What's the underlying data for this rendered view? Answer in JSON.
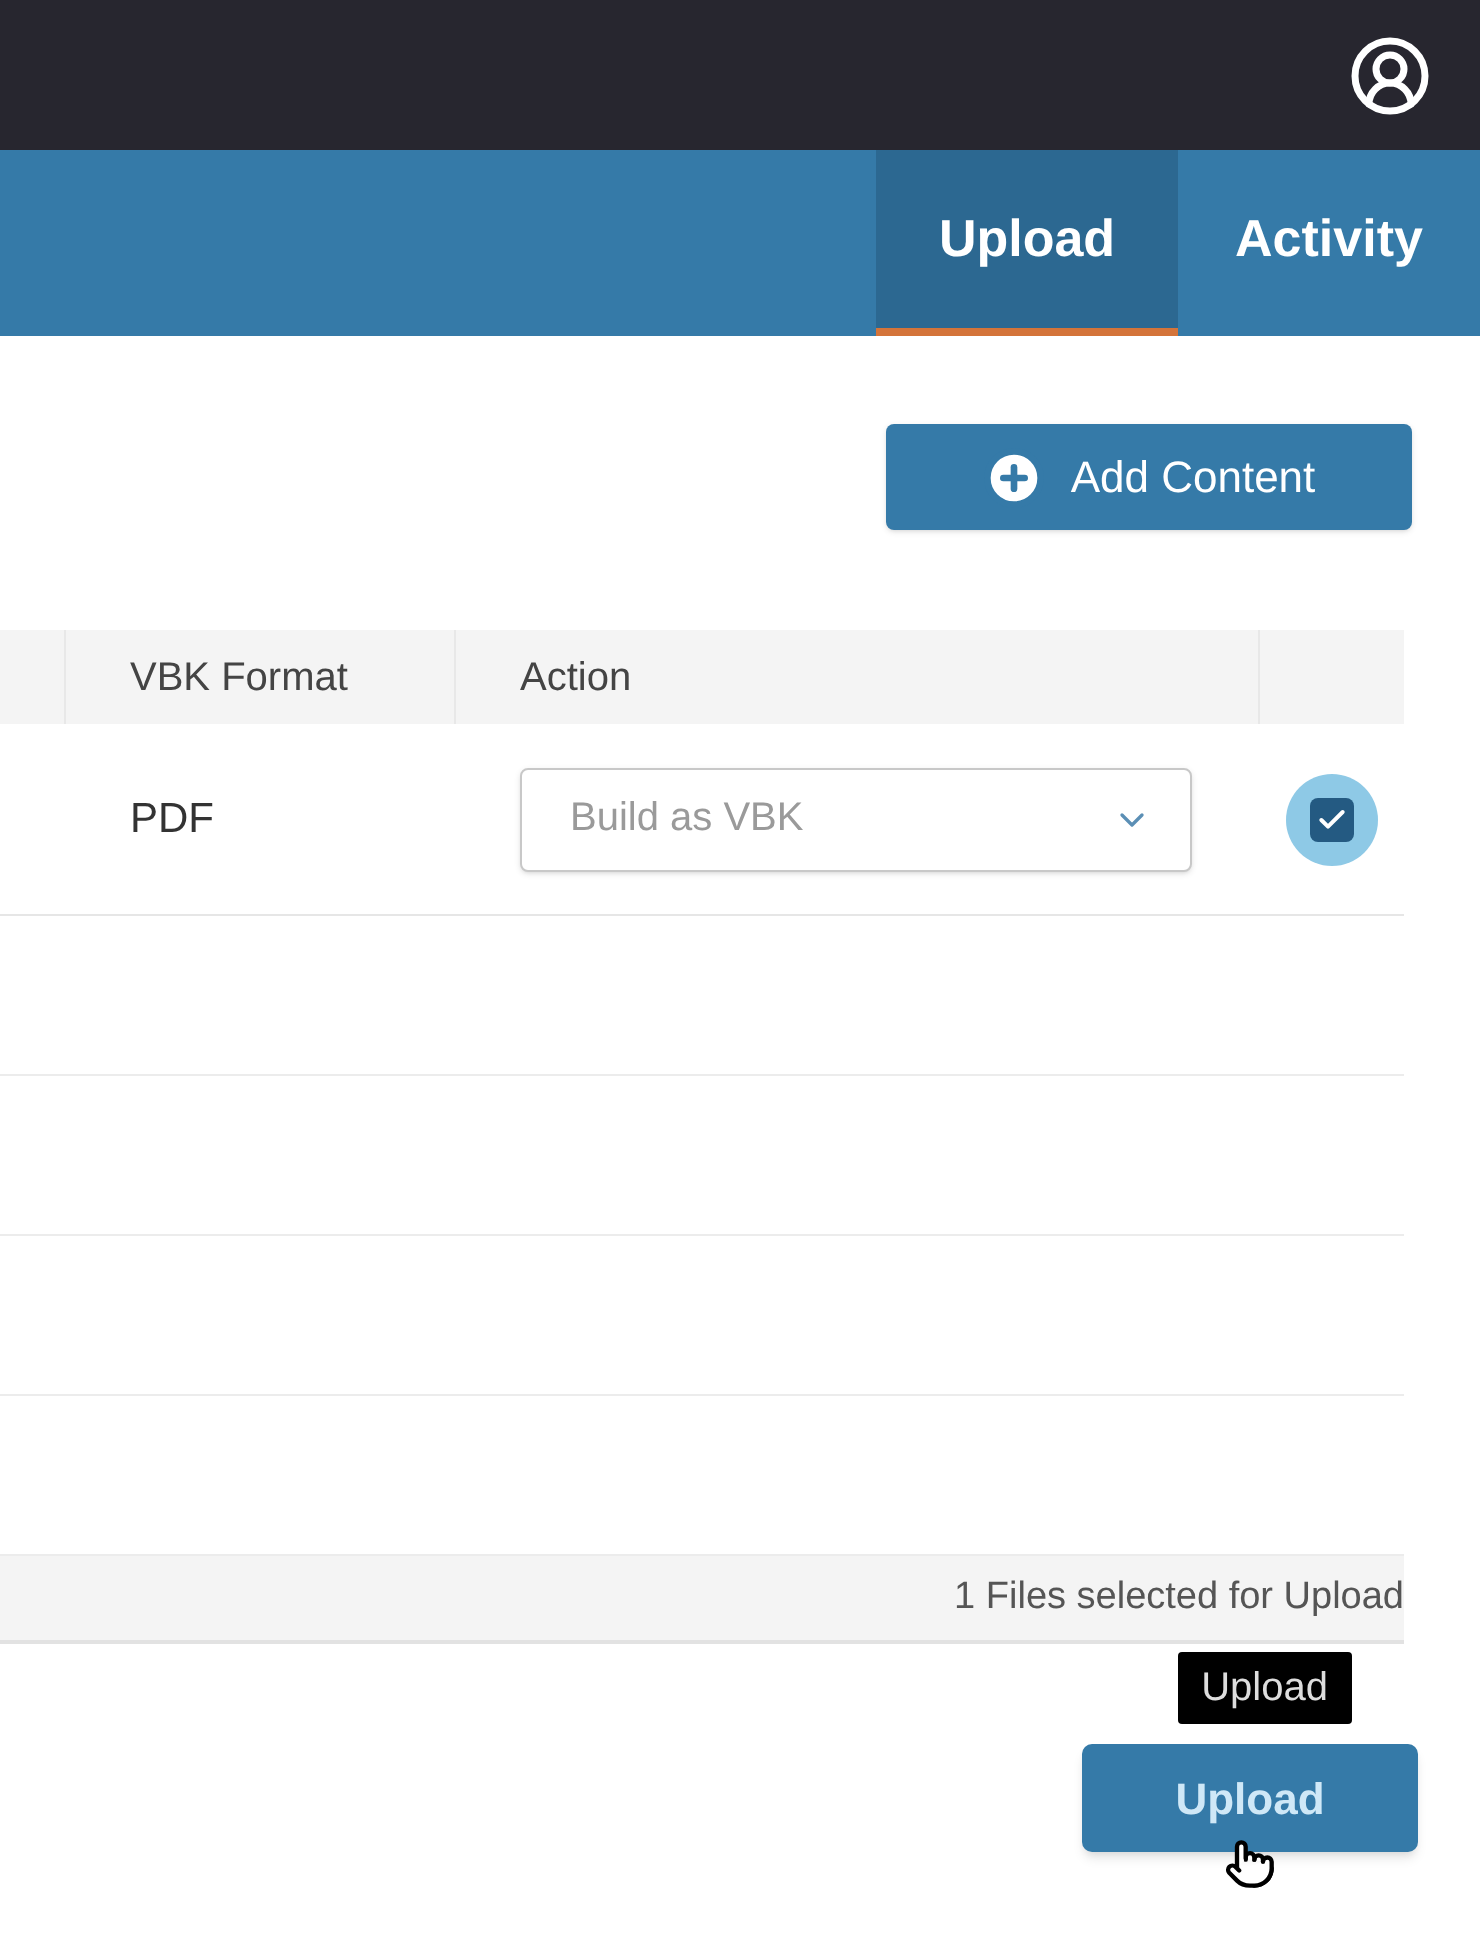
{
  "nav": {
    "tabs": [
      {
        "label": "Upload",
        "selected": true
      },
      {
        "label": "Activity",
        "selected": false
      }
    ]
  },
  "add_button": {
    "label": "Add Content"
  },
  "table": {
    "columns": [
      "VBK Format",
      "Action"
    ],
    "rows": [
      {
        "vbk_format": "PDF",
        "action": {
          "placeholder": "Build as VBK"
        },
        "checked": true
      }
    ]
  },
  "footer": {
    "status": "1 Files selected for Upload"
  },
  "tooltip": "Upload",
  "upload_button": {
    "label": "Upload"
  }
}
